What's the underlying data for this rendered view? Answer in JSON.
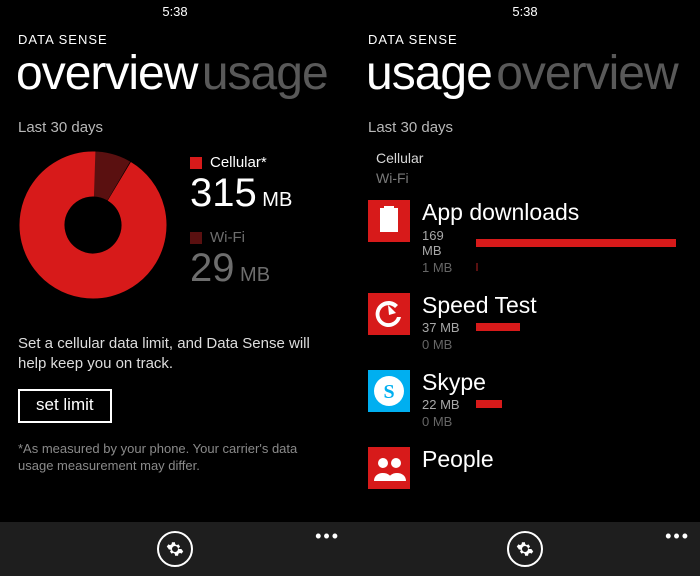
{
  "left": {
    "time": "5:38",
    "app": "DATA SENSE",
    "tab_active": "overview",
    "tab_inactive": "usage",
    "subhead": "Last 30 days",
    "cellular_label": "Cellular*",
    "cellular_value": "315",
    "cellular_unit": " MB",
    "wifi_label": "Wi-Fi",
    "wifi_value": "29",
    "wifi_unit": " MB",
    "tip": "Set a cellular data limit, and Data Sense will help keep you on track.",
    "btn": "set limit",
    "footnote": "*As measured by your phone. Your carrier's data usage measurement may differ."
  },
  "right": {
    "time": "5:38",
    "app": "DATA SENSE",
    "tab_active": "usage",
    "tab_inactive": "overview",
    "subhead": "Last 30 days",
    "legend_cellular": "Cellular",
    "legend_wifi": "Wi-Fi",
    "apps": [
      {
        "name": "App downloads",
        "cel": "169 MB",
        "wifi": "1 MB",
        "cel_w": 200,
        "wifi_w": 2
      },
      {
        "name": "Speed Test",
        "cel": "37 MB",
        "wifi": "0 MB",
        "cel_w": 44,
        "wifi_w": 0
      },
      {
        "name": "Skype",
        "cel": "22 MB",
        "wifi": "0 MB",
        "cel_w": 26,
        "wifi_w": 0
      },
      {
        "name": "People",
        "cel": "",
        "wifi": "",
        "cel_w": 0,
        "wifi_w": 0
      }
    ]
  },
  "chart_data": {
    "type": "pie",
    "title": "Last 30 days",
    "series": [
      {
        "name": "Cellular",
        "value": 315,
        "unit": "MB",
        "color": "#d71a1a"
      },
      {
        "name": "Wi-Fi",
        "value": 29,
        "unit": "MB",
        "color": "#5a1010"
      }
    ]
  }
}
